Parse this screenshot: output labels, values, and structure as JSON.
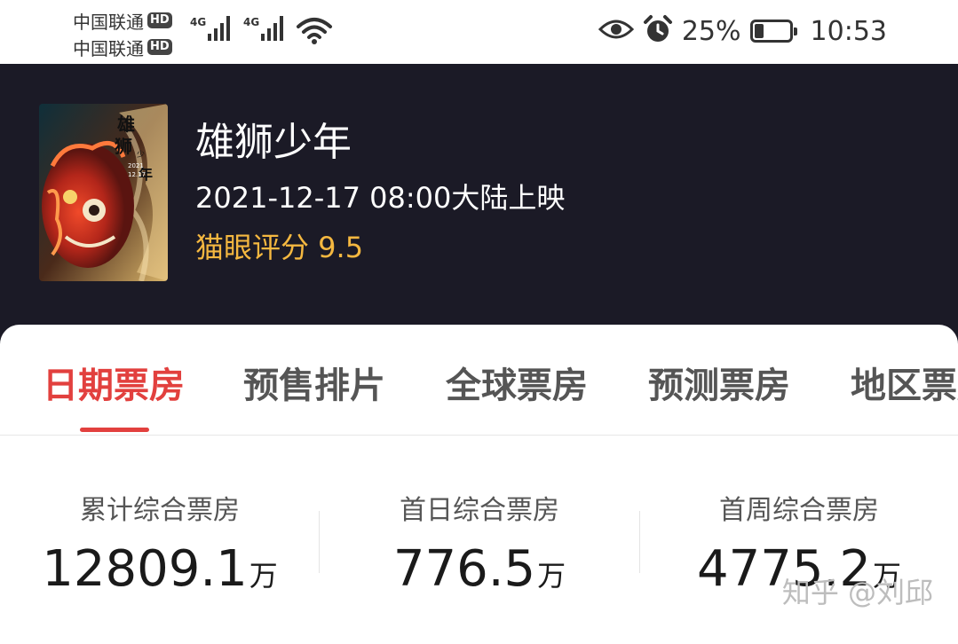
{
  "status_bar": {
    "carriers": [
      {
        "name": "中国联通",
        "badge": "HD"
      },
      {
        "name": "中国联通",
        "badge": "HD"
      }
    ],
    "signals": [
      {
        "network": "4G"
      },
      {
        "network": "4G"
      }
    ],
    "battery_percent": "25%",
    "battery_level": 0.25,
    "time": "10:53",
    "icons": [
      "eye-icon",
      "alarm-icon",
      "wifi-icon",
      "battery-icon"
    ]
  },
  "movie": {
    "title": "雄狮少年",
    "release": "2021-12-17 08:00大陆上映",
    "rating": "猫眼评分 9.5",
    "rating_color": "#f5b840"
  },
  "tabs": [
    {
      "label": "日期票房",
      "active": true
    },
    {
      "label": "预售排片",
      "active": false
    },
    {
      "label": "全球票房",
      "active": false
    },
    {
      "label": "预测票房",
      "active": false
    },
    {
      "label": "地区票房",
      "active": false
    }
  ],
  "stats": [
    {
      "label": "累计综合票房",
      "value": "12809.1",
      "unit": "万"
    },
    {
      "label": "首日综合票房",
      "value": "776.5",
      "unit": "万"
    },
    {
      "label": "首周综合票房",
      "value": "4775.2",
      "unit": "万"
    }
  ],
  "watermark": "知乎 @刘邱",
  "colors": {
    "accent": "#e2403e",
    "header_bg": "#1b1a26",
    "rating": "#f5b840"
  }
}
